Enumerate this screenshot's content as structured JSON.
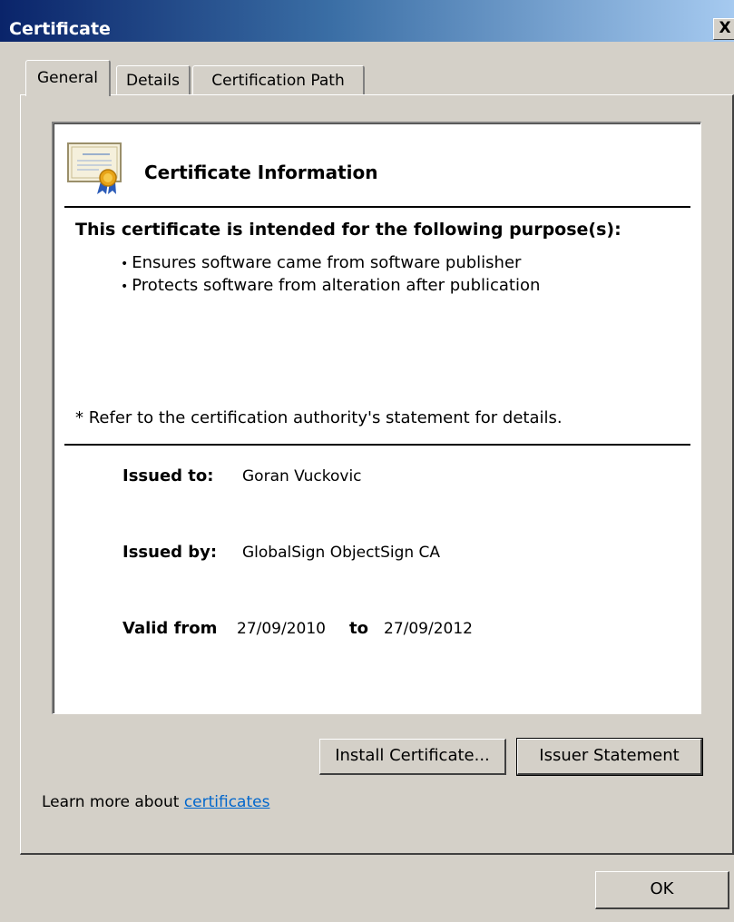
{
  "window": {
    "title": "Certificate",
    "close_label": "X"
  },
  "tabs": [
    {
      "label": "General",
      "active": true
    },
    {
      "label": "Details",
      "active": false
    },
    {
      "label": "Certification Path",
      "active": false
    }
  ],
  "info": {
    "icon": "certificate-icon",
    "title": "Certificate Information",
    "purpose_heading": "This certificate is intended for the following purpose(s):",
    "purposes": [
      "Ensures software came from software publisher",
      "Protects software from alteration after publication"
    ],
    "refer_note": "* Refer to the certification authority's statement for details.",
    "issued_to_label": "Issued to:",
    "issued_to": "Goran Vuckovic",
    "issued_by_label": "Issued by:",
    "issued_by": "GlobalSign ObjectSign CA",
    "valid_from_label": "Valid from",
    "valid_from": "27/09/2010",
    "valid_to_label": "to",
    "valid_to": "27/09/2012"
  },
  "buttons": {
    "install": "Install Certificate...",
    "issuer_statement": "Issuer Statement",
    "ok": "OK"
  },
  "footer": {
    "learn_prefix": "Learn more about",
    "learn_link": "certificates"
  }
}
